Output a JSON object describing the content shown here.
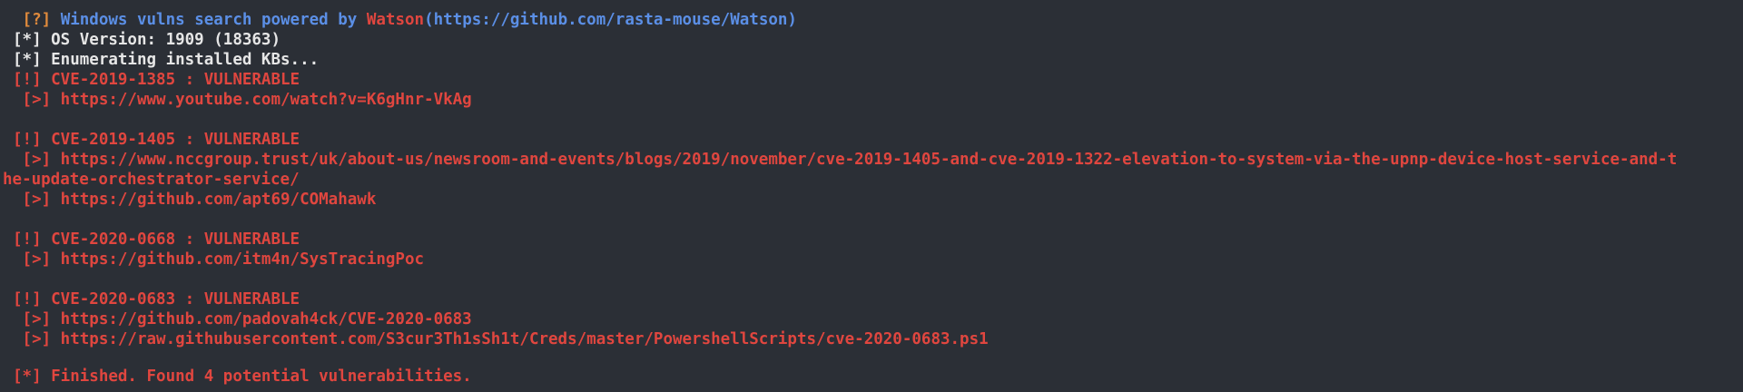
{
  "header": {
    "prefix": " [?] ",
    "text_a": "Windows vulns search powered by ",
    "watson_name": "Watson",
    "text_b": "(https://github.com/rasta-mouse/Watson)"
  },
  "info": [
    "[*] OS Version: 1909 (18363)",
    "[*] Enumerating installed KBs..."
  ],
  "cve_1385": {
    "title": "[!] CVE-2019-1385 : VULNERABLE",
    "link_1": " [>] https://www.youtube.com/watch?v=K6gHnr-VkAg"
  },
  "cve_1405": {
    "title": "[!] CVE-2019-1405 : VULNERABLE",
    "link_1_a": " [>] https://www.nccgroup.trust/uk/about-us/newsroom-and-events/blogs/2019/november/cve-2019-1405-and-cve-2019-1322-elevation-to-system-via-the-upnp-device-host-service-and-t",
    "link_1_b": "he-update-orchestrator-service/",
    "link_2": " [>] https://github.com/apt69/COMahawk"
  },
  "cve_0668": {
    "title": "[!] CVE-2020-0668 : VULNERABLE",
    "link_1": " [>] https://github.com/itm4n/SysTracingPoc"
  },
  "cve_0683": {
    "title": "[!] CVE-2020-0683 : VULNERABLE",
    "link_1": " [>] https://github.com/padovah4ck/CVE-2020-0683",
    "link_2": " [>] https://raw.githubusercontent.com/S3cur3Th1sSh1t/Creds/master/PowershellScripts/cve-2020-0683.ps1"
  },
  "footer": "[*] Finished. Found 4 potential vulnerabilities.",
  "colors": {
    "background": "#2b2f36",
    "text": "#e6e6e6",
    "prompt_orange": "#e08a3c",
    "header_blue": "#5b8fe6",
    "vuln_red": "#e0463f"
  }
}
